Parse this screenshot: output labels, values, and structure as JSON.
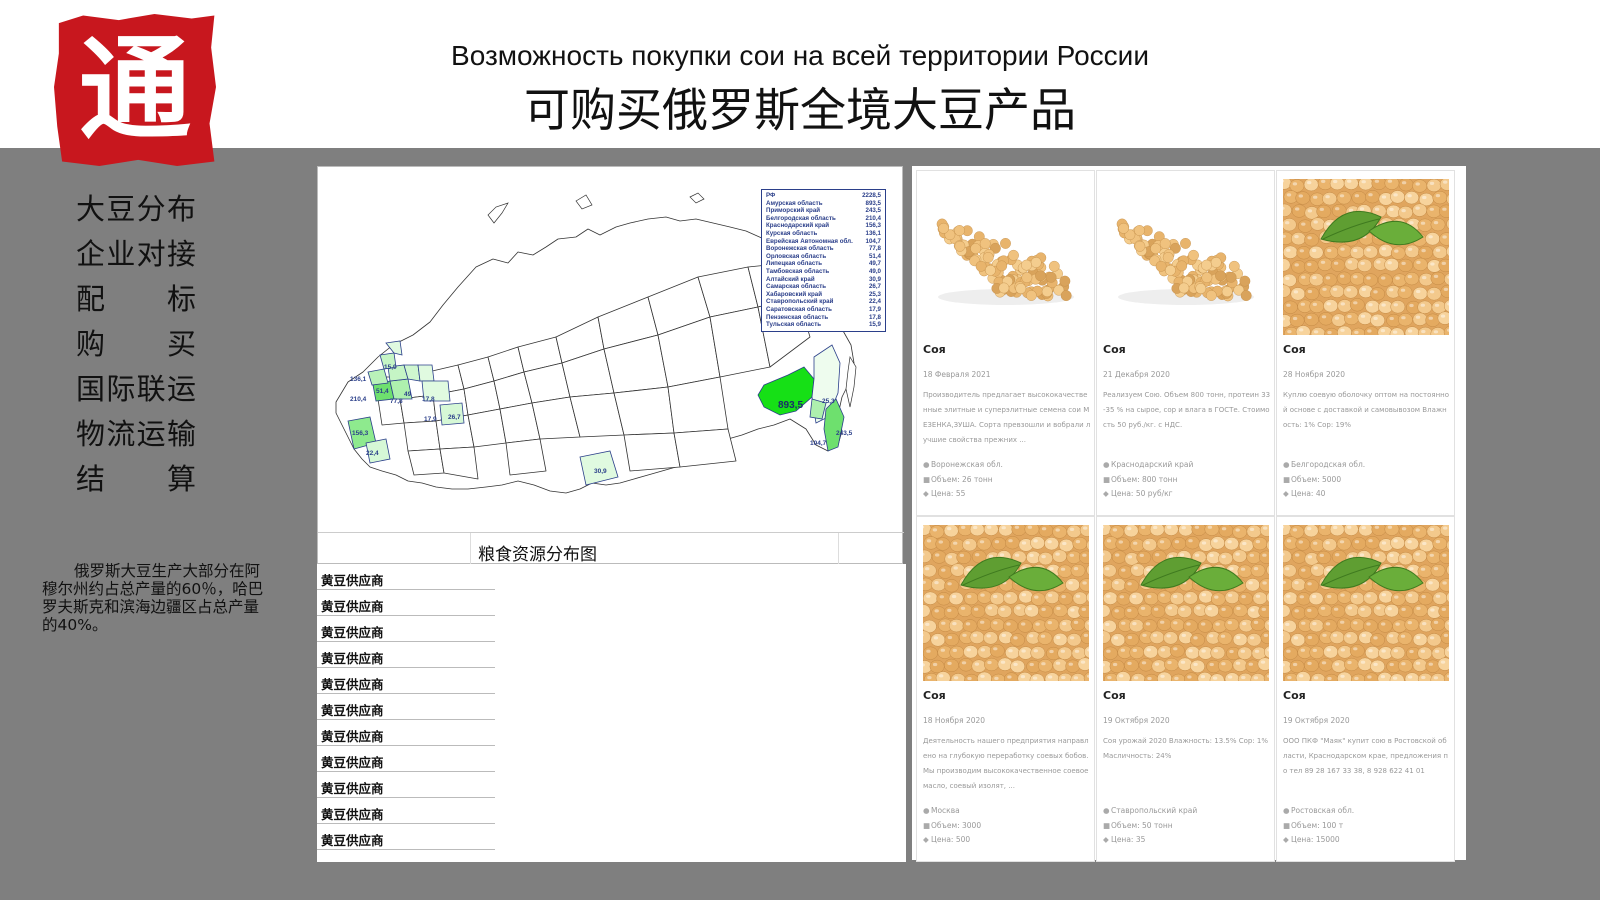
{
  "logo": {
    "char": "通"
  },
  "header": {
    "title_ru": "Возможность покупки сои на всей территории России",
    "title_zh": "可购买俄罗斯全境大豆产品"
  },
  "menu": [
    "大豆分布",
    "企业对接",
    "配标",
    "购买",
    "国际联运",
    "物流运输",
    "结算"
  ],
  "description": "俄罗斯大豆生产大部分在阿穆尔州约占总产量的60％，哈巴罗夫斯克和滨海边疆区占总产量的40%。",
  "map": {
    "caption": "粮食资源分布图",
    "legend": [
      {
        "region": "РФ",
        "value": "2228,5"
      },
      {
        "region": "Амурская область",
        "value": "893,5"
      },
      {
        "region": "Приморский край",
        "value": "243,5"
      },
      {
        "region": "Белгородская область",
        "value": "210,4"
      },
      {
        "region": "Краснодарский край",
        "value": "156,3"
      },
      {
        "region": "Курская область",
        "value": "136,1"
      },
      {
        "region": "Еврейская Автономная обл.",
        "value": "104,7"
      },
      {
        "region": "Воронежская область",
        "value": "77,8"
      },
      {
        "region": "Орловская область",
        "value": "51,4"
      },
      {
        "region": "Липецкая область",
        "value": "49,7"
      },
      {
        "region": "Тамбовская область",
        "value": "49,0"
      },
      {
        "region": "Алтайский край",
        "value": "30,9"
      },
      {
        "region": "Самарская область",
        "value": "26,7"
      },
      {
        "region": "Хабаровский край",
        "value": "25,3"
      },
      {
        "region": "Ставропольский край",
        "value": "22,4"
      },
      {
        "region": "Саратовская область",
        "value": "17,9"
      },
      {
        "region": "Пензенская область",
        "value": "17,8"
      },
      {
        "region": "Тульская область",
        "value": "15,9"
      }
    ],
    "labels": [
      "136,1",
      "210,4",
      "156,3",
      "22,4",
      "77,8",
      "49",
      "17,8",
      "17,9",
      "26,7",
      "30,9",
      "893,5",
      "25,3",
      "104,7",
      "243,5",
      "15,9",
      "51,4"
    ]
  },
  "suppliers": [
    "黄豆供应商",
    "黄豆供应商",
    "黄豆供应商",
    "黄豆供应商",
    "黄豆供应商",
    "黄豆供应商",
    "黄豆供应商",
    "黄豆供应商",
    "黄豆供应商",
    "黄豆供应商",
    "黄豆供应商"
  ],
  "cards": [
    {
      "title": "Соя",
      "date": "18 Февраля 2021",
      "image": "soybean-pile",
      "desc": "Производитель предлагает высококачественные элитные и суперэлитные семена сои МЕЗЕНКА,ЗУША. Сорта превзошли и вобрали лучшие свойства прежних ...",
      "region": "Воронежская обл.",
      "volume": "Объем: 26 тонн",
      "price": "Цена: 55"
    },
    {
      "title": "Соя",
      "date": "21 Декабря 2020",
      "image": "soybean-pile",
      "desc": "Реализуем Сою. Объем 800 тонн, протеин 33-35 % на сырое, сор и влага в ГОСТе. Стоимость 50 руб./кг. с НДС.",
      "region": "Краснодарский край",
      "volume": "Объем: 800 тонн",
      "price": "Цена: 50 руб/кг"
    },
    {
      "title": "Соя",
      "date": "28 Ноября 2020",
      "image": "soybean-leaf",
      "desc": "Куплю соевую оболочку оптом на постоянной основе с доставкой и самовывозом Влажность: 1% Сор: 19%",
      "region": "Белгородская обл.",
      "volume": "Объем: 5000",
      "price": "Цена: 40"
    },
    {
      "title": "Соя",
      "date": "18 Ноября 2020",
      "image": "soybean-leaf",
      "desc": "Деятельность нашего предприятия направлено на глубокую переработку соевых бобов. Мы производим высококачественное соевое масло, соевый изолят, ...",
      "region": "Москва",
      "volume": "Объем: 3000",
      "price": "Цена: 500"
    },
    {
      "title": "Соя",
      "date": "19 Октября 2020",
      "image": "soybean-leaf",
      "desc": "Соя урожай 2020 Влажность: 13.5% Сор: 1% Масличность: 24%",
      "region": "Ставропольский край",
      "volume": "Объем: 50 тонн",
      "price": "Цена: 35"
    },
    {
      "title": "Соя",
      "date": "19 Октября 2020",
      "image": "soybean-leaf",
      "desc": "ООО ПКФ \"Маяк\" купит сою в Ростовской области, Краснодарском крае, предложения по тел 89 28 167 33 38, 8 928 622 41 01",
      "region": "Ростовская обл.",
      "volume": "Объем: 100 т",
      "price": "Цена: 15000"
    }
  ]
}
